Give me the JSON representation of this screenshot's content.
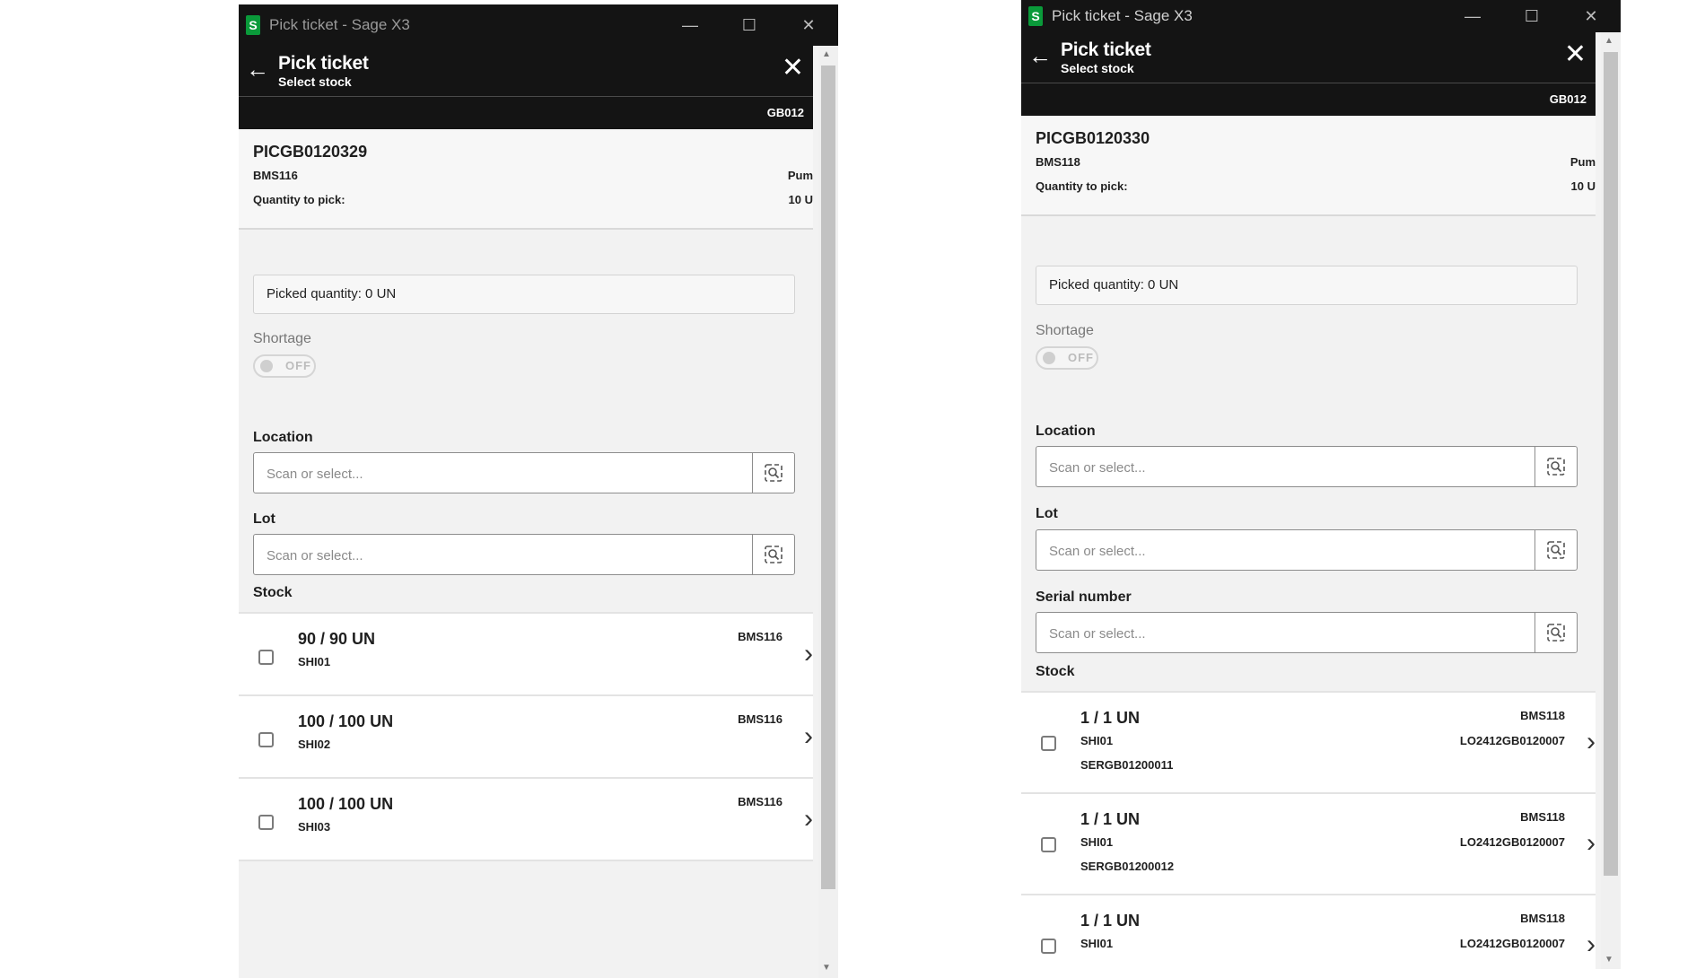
{
  "windows": [
    {
      "title": "Pick ticket - Sage X3",
      "header": {
        "title": "Pick ticket",
        "subtitle": "Select stock"
      },
      "site": "GB012",
      "summary": {
        "ticket": "PICGB0120329",
        "product": "BMS116",
        "description": "Pum",
        "qty_label": "Quantity to pick:",
        "qty_value": "10 U"
      },
      "picked": "Picked quantity: 0 UN",
      "shortage": {
        "label": "Shortage",
        "state": "OFF"
      },
      "fields": {
        "location": {
          "label": "Location",
          "placeholder": "Scan or select..."
        },
        "lot": {
          "label": "Lot",
          "placeholder": "Scan or select..."
        }
      },
      "stock_label": "Stock",
      "stock": [
        {
          "qty": "90 / 90 UN",
          "location": "SHI01",
          "product": "BMS116"
        },
        {
          "qty": "100 / 100 UN",
          "location": "SHI02",
          "product": "BMS116"
        },
        {
          "qty": "100 / 100 UN",
          "location": "SHI03",
          "product": "BMS116"
        }
      ]
    },
    {
      "title": "Pick ticket - Sage X3",
      "header": {
        "title": "Pick ticket",
        "subtitle": "Select stock"
      },
      "site": "GB012",
      "summary": {
        "ticket": "PICGB0120330",
        "product": "BMS118",
        "description": "Pum",
        "qty_label": "Quantity to pick:",
        "qty_value": "10 U"
      },
      "picked": "Picked quantity: 0 UN",
      "shortage": {
        "label": "Shortage",
        "state": "OFF"
      },
      "fields": {
        "location": {
          "label": "Location",
          "placeholder": "Scan or select..."
        },
        "lot": {
          "label": "Lot",
          "placeholder": "Scan or select..."
        },
        "serial": {
          "label": "Serial number",
          "placeholder": "Scan or select..."
        }
      },
      "stock_label": "Stock",
      "stock": [
        {
          "qty": "1 / 1 UN",
          "location": "SHI01",
          "serial": "SERGB01200011",
          "product": "BMS118",
          "lot": "LO2412GB0120007"
        },
        {
          "qty": "1 / 1 UN",
          "location": "SHI01",
          "serial": "SERGB01200012",
          "product": "BMS118",
          "lot": "LO2412GB0120007"
        },
        {
          "qty": "1 / 1 UN",
          "location": "SHI01",
          "product": "BMS118",
          "lot": "LO2412GB0120007"
        }
      ]
    }
  ],
  "icons": {
    "app": "sage-s-icon",
    "minimize": "minimize-icon",
    "maximize": "maximize-icon",
    "close": "close-icon",
    "back": "back-arrow-icon",
    "lookup": "lookup-search-icon",
    "chevron": "chevron-right-icon"
  },
  "colors": {
    "titlebar": "#141414",
    "accent": "#1aa8a0",
    "app_icon": "#0a9a3a",
    "panel": "#f2f2f2"
  }
}
